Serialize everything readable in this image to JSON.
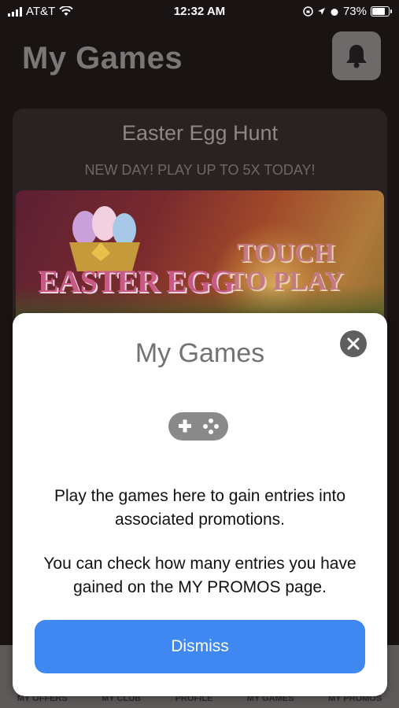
{
  "status_bar": {
    "carrier": "AT&T",
    "time": "12:32 AM",
    "battery": "73%",
    "battery_level": 0.73
  },
  "header": {
    "title": "My Games",
    "bell_icon": "bell-icon"
  },
  "game_card": {
    "title": "Easter Egg Hunt",
    "subtitle": "NEW DAY! PLAY UP TO 5X TODAY!",
    "banner_logo": "EASTER EGG",
    "banner_cta": "TOUCH TO PLAY"
  },
  "tab_bar": {
    "items": [
      "MY OFFERS",
      "MY CLUB",
      "PROFILE",
      "MY GAMES",
      "MY PROMOS"
    ]
  },
  "modal": {
    "title": "My Games",
    "close_icon": "close-icon",
    "gamepad_icon": "gamepad-icon",
    "paragraph1": "Play the games here to gain entries into associated promotions.",
    "paragraph2": "You can check how many entries you have gained on the MY PROMOS page.",
    "dismiss_label": "Dismiss"
  },
  "colors": {
    "accent": "#3f88f2",
    "background": "#1a1313",
    "modal": "#ffffff"
  }
}
